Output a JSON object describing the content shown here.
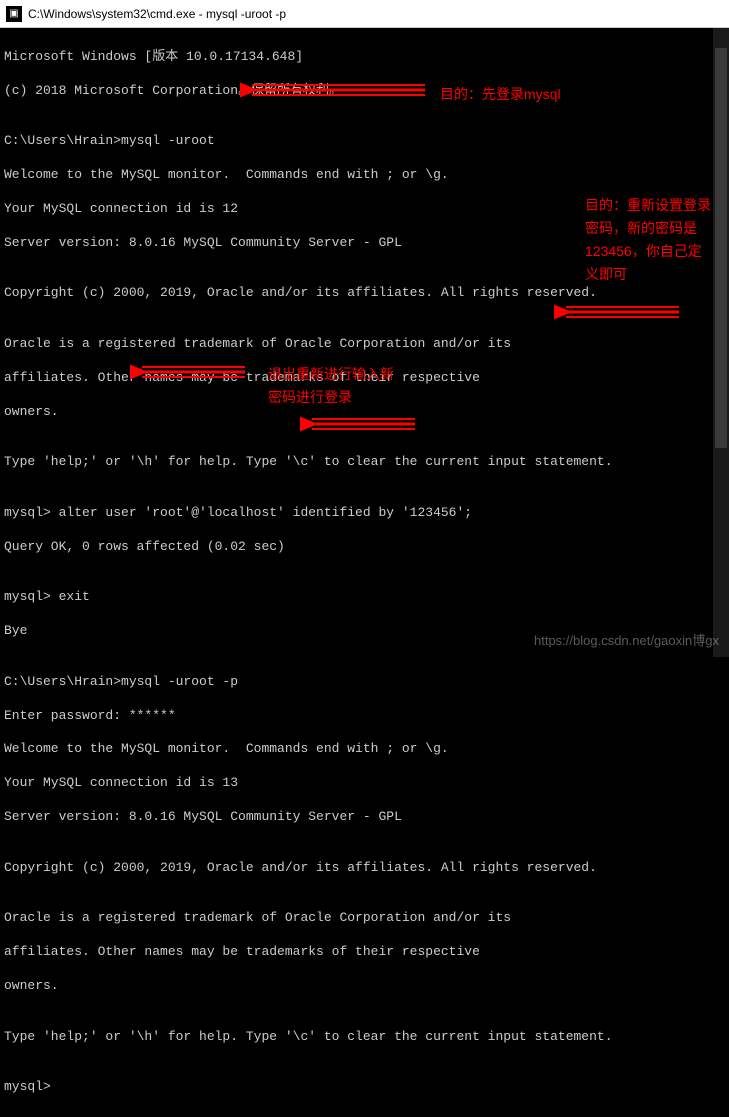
{
  "titlebar": {
    "icon_glyph": "C:\\",
    "text": "C:\\Windows\\system32\\cmd.exe - mysql  -uroot -p"
  },
  "lines": {
    "l1": "Microsoft Windows [版本 10.0.17134.648]",
    "l2": "(c) 2018 Microsoft Corporation。保留所有权利。",
    "l3": "",
    "l4": "C:\\Users\\Hrain>mysql -uroot",
    "l5": "Welcome to the MySQL monitor.  Commands end with ; or \\g.",
    "l6": "Your MySQL connection id is 12",
    "l7": "Server version: 8.0.16 MySQL Community Server - GPL",
    "l8": "",
    "l9": "Copyright (c) 2000, 2019, Oracle and/or its affiliates. All rights reserved.",
    "l10": "",
    "l11": "Oracle is a registered trademark of Oracle Corporation and/or its",
    "l12": "affiliates. Other names may be trademarks of their respective",
    "l13": "owners.",
    "l14": "",
    "l15": "Type 'help;' or '\\h' for help. Type '\\c' to clear the current input statement.",
    "l16": "",
    "l17": "mysql> alter user 'root'@'localhost' identified by '123456';",
    "l18": "Query OK, 0 rows affected (0.02 sec)",
    "l19": "",
    "l20": "mysql> exit",
    "l21": "Bye",
    "l22": "",
    "l23": "C:\\Users\\Hrain>mysql -uroot -p",
    "l24": "Enter password: ******",
    "l25": "Welcome to the MySQL monitor.  Commands end with ; or \\g.",
    "l26": "Your MySQL connection id is 13",
    "l27": "Server version: 8.0.16 MySQL Community Server - GPL",
    "l28": "",
    "l29": "Copyright (c) 2000, 2019, Oracle and/or its affiliates. All rights reserved.",
    "l30": "",
    "l31": "Oracle is a registered trademark of Oracle Corporation and/or its",
    "l32": "affiliates. Other names may be trademarks of their respective",
    "l33": "owners.",
    "l34": "",
    "l35": "Type 'help;' or '\\h' for help. Type '\\c' to clear the current input statement.",
    "l36": "",
    "l37": "mysql>"
  },
  "annotations": {
    "a1": "目的：先登录mysql",
    "a2_line1": "目的：重新设置登录",
    "a2_line2": "密码，新的密码是",
    "a2_line3": "123456，你自己定",
    "a2_line4": "义即可",
    "a3_line1": "退出重新进行输入新",
    "a3_line2": "密码进行登录"
  },
  "watermark": "https://blog.csdn.net/gaoxin博gx"
}
